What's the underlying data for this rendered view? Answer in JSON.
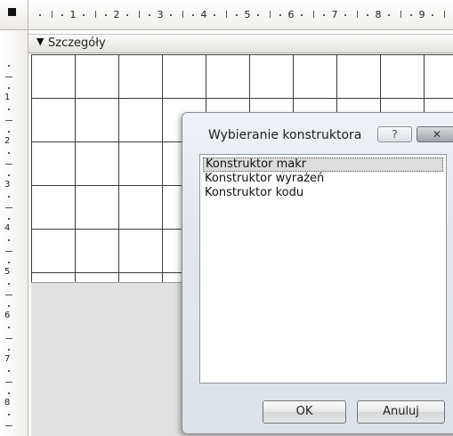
{
  "ruler": {
    "horizontal_labels": [
      "1",
      "2",
      "3",
      "4",
      "5",
      "6",
      "7",
      "8",
      "9"
    ],
    "vertical_labels": [
      "1",
      "2",
      "3",
      "4",
      "5",
      "6",
      "7",
      "8"
    ]
  },
  "section": {
    "icon": "section-arrow-icon",
    "label": "Szczegóły"
  },
  "dialog": {
    "title": "Wybieranie konstruktora",
    "help_label": "?",
    "close_label": "✕",
    "options": [
      "Konstruktor makr",
      "Konstruktor wyrażeń",
      "Konstruktor kodu"
    ],
    "selected_option": "Konstruktor makr",
    "ok_label": "OK",
    "cancel_label": "Anuluj"
  }
}
